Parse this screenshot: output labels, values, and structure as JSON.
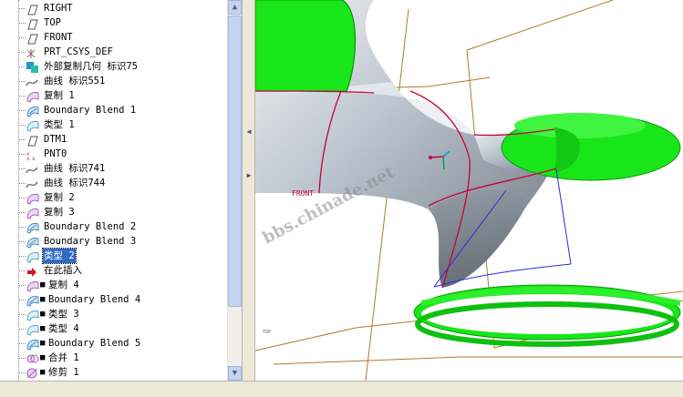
{
  "tree": {
    "items": [
      {
        "label": "RIGHT",
        "icon": "datum-plane-icon",
        "mark": ""
      },
      {
        "label": "TOP",
        "icon": "datum-plane-icon",
        "mark": ""
      },
      {
        "label": "FRONT",
        "icon": "datum-plane-icon",
        "mark": ""
      },
      {
        "label": "PRT_CSYS_DEF",
        "icon": "coordinate-system-icon",
        "mark": ""
      },
      {
        "label": "外部复制几何 标识75",
        "icon": "external-copy-geometry-icon",
        "mark": ""
      },
      {
        "label": "曲线 标识551",
        "icon": "curve-icon",
        "mark": ""
      },
      {
        "label": "复制 1",
        "icon": "copy-surface-icon",
        "mark": ""
      },
      {
        "label": "Boundary Blend 1",
        "icon": "boundary-blend-icon",
        "mark": ""
      },
      {
        "label": "类型 1",
        "icon": "style-icon",
        "mark": ""
      },
      {
        "label": "DTM1",
        "icon": "datum-plane-icon",
        "mark": ""
      },
      {
        "label": "PNT0",
        "icon": "datum-point-icon",
        "mark": ""
      },
      {
        "label": "曲线 标识741",
        "icon": "curve-icon",
        "mark": ""
      },
      {
        "label": "曲线 标识744",
        "icon": "curve-icon",
        "mark": ""
      },
      {
        "label": "复制 2",
        "icon": "copy-surface-icon",
        "mark": ""
      },
      {
        "label": "复制 3",
        "icon": "copy-surface-icon",
        "mark": ""
      },
      {
        "label": "Boundary Blend 2",
        "icon": "boundary-blend-icon",
        "mark": ""
      },
      {
        "label": "Boundary Blend 3",
        "icon": "boundary-blend-icon",
        "mark": ""
      },
      {
        "label": "类型 2",
        "icon": "style-icon",
        "mark": "",
        "selected": true
      },
      {
        "label": "在此插入",
        "icon": "insert-here-arrow-icon",
        "mark": ""
      },
      {
        "label": "复制 4",
        "icon": "copy-surface-icon",
        "mark": "■"
      },
      {
        "label": "Boundary Blend 4",
        "icon": "boundary-blend-icon",
        "mark": "■"
      },
      {
        "label": "类型 3",
        "icon": "style-icon",
        "mark": "■"
      },
      {
        "label": "类型 4",
        "icon": "style-icon",
        "mark": "■"
      },
      {
        "label": "Boundary Blend 5",
        "icon": "boundary-blend-icon",
        "mark": "■"
      },
      {
        "label": "合并 1",
        "icon": "merge-icon",
        "mark": "■"
      },
      {
        "label": "修剪 1",
        "icon": "trim-icon",
        "mark": "■"
      }
    ]
  },
  "viewport": {
    "watermark": "bbs.chinade.net",
    "label_curve": "FRONT",
    "label_corner": "TOP",
    "colors": {
      "green": "#19e619",
      "surface": "#b8c2cc",
      "datum": "#b07a2a",
      "curve": "#c8003c",
      "blue": "#2a2ae6"
    }
  }
}
